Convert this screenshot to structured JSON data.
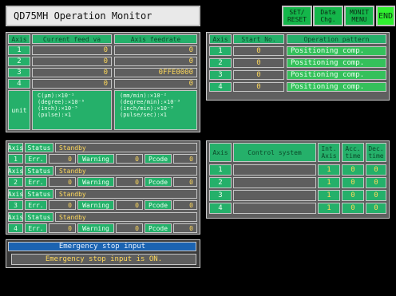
{
  "window": {
    "title": "QD75MH Operation Monitor"
  },
  "toolbar": {
    "set_reset_label": "SET/\nRESET",
    "data_chg_label": "Data\nChg.",
    "mon_menu_label": "MONIT\nMENU",
    "end_label": "END"
  },
  "left_top_table": {
    "headers": [
      "Axis",
      "Current feed va",
      "Axis feedrate"
    ],
    "rows": [
      {
        "axis": "1",
        "current": "0",
        "feedrate": "0"
      },
      {
        "axis": "2",
        "current": "0",
        "feedrate": "0"
      },
      {
        "axis": "3",
        "current": "0",
        "feedrate": "0FFE0000"
      },
      {
        "axis": "4",
        "current": "0",
        "feedrate": "0"
      }
    ],
    "unit_label": "unit",
    "unit_left_text": "C(µm):×10⁻¹\n(degree):×10⁻⁵\n(inch):×10⁻⁵\n(pulse):×1",
    "unit_right_text": "(mm/min):×10⁻²\n(degree/min):×10⁻³\n(inch/min):×10⁻³\n(pulse/sec):×1"
  },
  "axis_status_blocks": [
    {
      "label_top": "Axis",
      "label_num": "1",
      "status_label": "Status",
      "status_value": "Standby",
      "err_label": "Err.",
      "err_value": "0",
      "warning_label": "Warning",
      "warning_value": "0",
      "pcode_label": "Pcode",
      "pcode_value": "0"
    },
    {
      "label_top": "Axis",
      "label_num": "2",
      "status_label": "Status",
      "status_value": "Standby",
      "err_label": "Err.",
      "err_value": "0",
      "warning_label": "Warning",
      "warning_value": "0",
      "pcode_label": "Pcode",
      "pcode_value": "0"
    },
    {
      "label_top": "Axis",
      "label_num": "3",
      "status_label": "Status",
      "status_value": "Standby",
      "err_label": "Err.",
      "err_value": "0",
      "warning_label": "Warning",
      "warning_value": "0",
      "pcode_label": "Pcode",
      "pcode_value": "0"
    },
    {
      "label_top": "Axis",
      "label_num": "4",
      "status_label": "Status",
      "status_value": "Standby",
      "err_label": "Err.",
      "err_value": "0",
      "warning_label": "Warning",
      "warning_value": "0",
      "pcode_label": "Pcode",
      "pcode_value": "0"
    }
  ],
  "emergency": {
    "header": "Emergency stop input",
    "message": "Emergency stop input is ON."
  },
  "right_top_table": {
    "headers": [
      "Axis",
      "Start No.",
      "Operation pattern"
    ],
    "rows": [
      {
        "axis": "1",
        "start": "0",
        "pattern": "Positioning comp."
      },
      {
        "axis": "2",
        "start": "0",
        "pattern": "Positioning comp."
      },
      {
        "axis": "3",
        "start": "0",
        "pattern": "Positioning comp."
      },
      {
        "axis": "4",
        "start": "0",
        "pattern": "Positioning comp."
      }
    ]
  },
  "right_bottom_table": {
    "headers": [
      "Axis",
      "Control system",
      "Int.\nAxis",
      "Acc.\ntime",
      "Dec.\ntime"
    ],
    "rows": [
      {
        "axis": "1",
        "control": "",
        "int": "1",
        "acc": "0",
        "dec": "0"
      },
      {
        "axis": "2",
        "control": "",
        "int": "1",
        "acc": "0",
        "dec": "0"
      },
      {
        "axis": "3",
        "control": "",
        "int": "1",
        "acc": "0",
        "dec": "0"
      },
      {
        "axis": "4",
        "control": "",
        "int": "1",
        "acc": "0",
        "dec": "0"
      }
    ]
  },
  "colors": {
    "green": "#25b06a",
    "gray": "#5f5f5f",
    "blue": "#1b63b1",
    "yellow_text": "#ffd95b"
  }
}
